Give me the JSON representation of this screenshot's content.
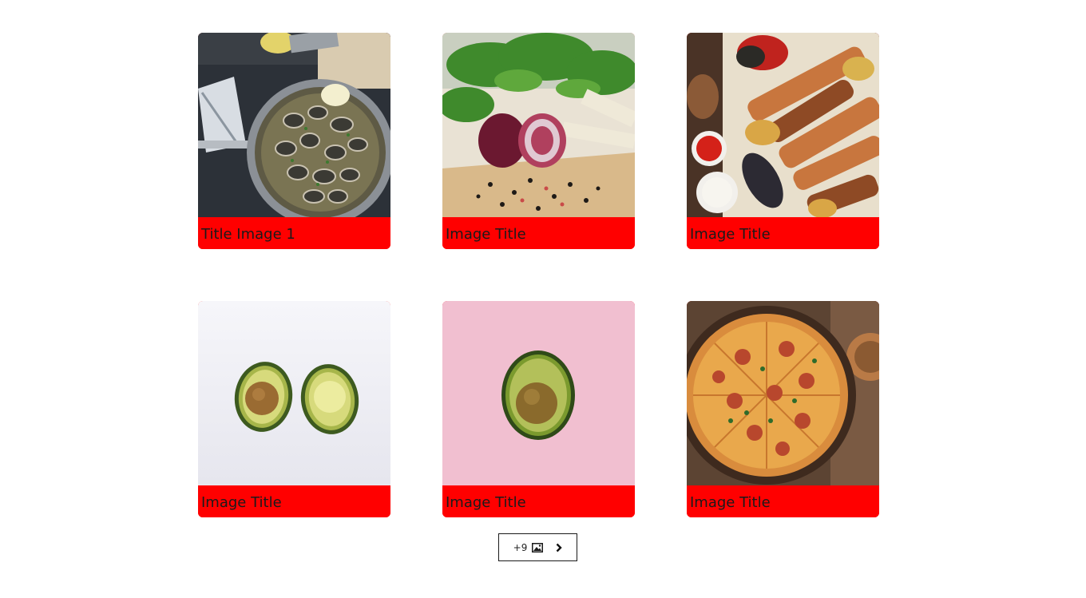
{
  "gallery": {
    "items": [
      {
        "title": "Title Image 1",
        "image": "clams-pan-photo"
      },
      {
        "title": "Image Title",
        "image": "onion-herbs-photo"
      },
      {
        "title": "Image Title",
        "image": "bbq-skewers-photo"
      },
      {
        "title": "Image Title",
        "image": "avocado-halves-photo"
      },
      {
        "title": "Image Title",
        "image": "avocado-pink-photo"
      },
      {
        "title": "Image Title",
        "image": "pizza-photo"
      }
    ],
    "caption_color": "#ff0000"
  },
  "more_button": {
    "count_label": "+9",
    "icon": "image-icon",
    "next_icon": "chevron-right-icon"
  }
}
